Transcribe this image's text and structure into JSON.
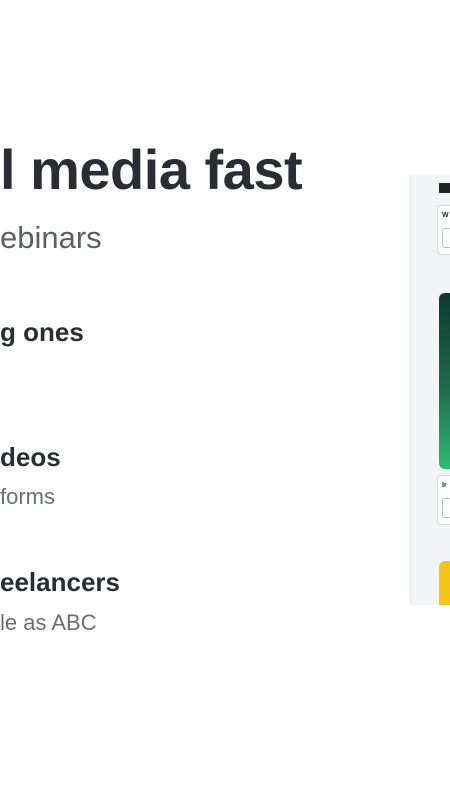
{
  "hero": {
    "headline": "l media fast",
    "subline": "ebinars"
  },
  "features": [
    {
      "title": "g ones",
      "desc": ""
    },
    {
      "title": "deos",
      "desc": "forms"
    },
    {
      "title": "eelancers",
      "desc": "le as ABC"
    }
  ],
  "preview": {
    "card_labels": [
      "W",
      "Ir"
    ],
    "colors": {
      "video_top": "#0d3b2e",
      "video_bottom": "#2bbd74",
      "highlight": "#f5c518"
    }
  }
}
